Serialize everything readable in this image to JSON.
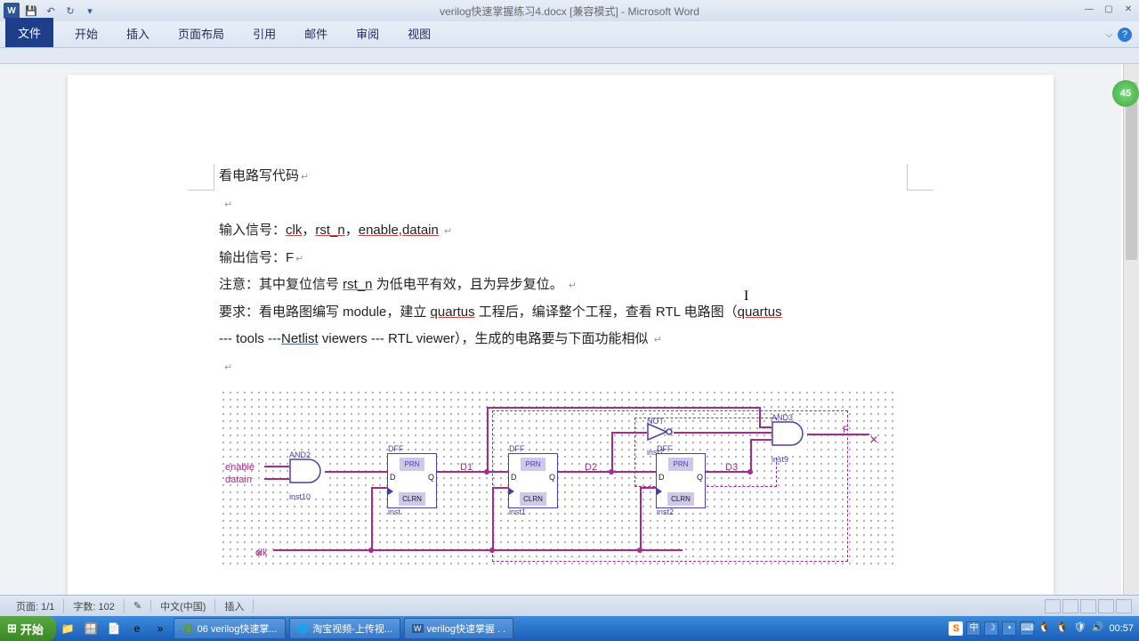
{
  "title": "verilog快速掌握练习4.docx [兼容模式] - Microsoft Word",
  "tabs": {
    "file": "文件",
    "home": "开始",
    "insert": "插入",
    "layout": "页面布局",
    "ref": "引用",
    "mail": "邮件",
    "review": "审阅",
    "view": "视图"
  },
  "doc": {
    "heading": "看电路写代码",
    "line_in_prefix": "输入信号：",
    "line_in_sig1": "clk",
    "line_in_sep1": "，",
    "line_in_sig2": "rst_n",
    "line_in_sep2": "，",
    "line_in_sig3": "enable,datain",
    "line_out": "输出信号：F",
    "note_prefix": "注意：其中复位信号 ",
    "note_sig": "rst_n",
    "note_suffix": " 为低电平有效，且为异步复位。",
    "req_prefix": "要求：看电路图编写 module，建立 ",
    "req_q1": "quartus",
    "req_mid1": " 工程后，编译整个工程，查看 RTL 电路图（",
    "req_q2": "quartus",
    "req_line2a": " --- tools ---",
    "req_nl": "Netlist",
    "req_line2b": " viewers --- RTL viewer），生成的电路要与下面功能相似"
  },
  "circuit": {
    "sig_enable": "enable",
    "sig_datain": "datain",
    "sig_clk": "clk",
    "sig_d1": "D1",
    "sig_d2": "D2",
    "sig_d3": "D3",
    "sig_f": "F",
    "and2": "AND2",
    "and3": "AND3",
    "not": "NOT",
    "dff": "DFF",
    "prn": "PRN",
    "clrn": "CLRN",
    "d": "D",
    "q": "Q",
    "inst10": "inst10",
    "inst": "inst",
    "inst1": "inst1",
    "inst2": "inst2",
    "inst7": "inst7",
    "inst9": "inst9"
  },
  "status": {
    "page": "页面: 1/1",
    "words": "字数: 102",
    "lang": "中文(中国)",
    "mode": "插入"
  },
  "taskbar": {
    "start": "开始",
    "t1": "06 verilog快速掌...",
    "t2": "淘宝视频-上传视...",
    "t3": "verilog快速掌握 . .",
    "time": "00:57",
    "ime1": "中",
    "ime_s": "S"
  },
  "badge": "45"
}
